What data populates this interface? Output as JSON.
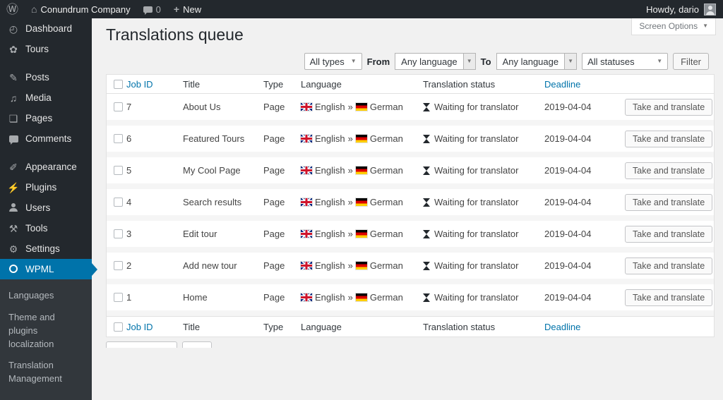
{
  "admin_bar": {
    "site_name": "Conundrum Company",
    "comments_count": "0",
    "new_label": "New",
    "howdy_text": "Howdy, dario"
  },
  "sidebar": {
    "items": [
      {
        "label": "Dashboard"
      },
      {
        "label": "Tours"
      },
      {
        "label": "Posts"
      },
      {
        "label": "Media"
      },
      {
        "label": "Pages"
      },
      {
        "label": "Comments"
      },
      {
        "label": "Appearance"
      },
      {
        "label": "Plugins"
      },
      {
        "label": "Users"
      },
      {
        "label": "Tools"
      },
      {
        "label": "Settings"
      },
      {
        "label": "WPML"
      }
    ],
    "wpml_submenu": [
      "Languages",
      "Theme and plugins localization",
      "Translation Management"
    ]
  },
  "page": {
    "title": "Translations queue",
    "screen_options_label": "Screen Options"
  },
  "filters": {
    "types_value": "All types",
    "from_label": "From",
    "from_language_value": "Any language",
    "to_label": "To",
    "to_language_value": "Any language",
    "statuses_value": "All statuses",
    "filter_button_label": "Filter"
  },
  "table": {
    "headers": {
      "job_id": "Job ID",
      "title": "Title",
      "type": "Type",
      "language": "Language",
      "status": "Translation status",
      "deadline": "Deadline"
    },
    "rows": [
      {
        "job_id": "7",
        "title": "About Us",
        "type": "Page",
        "language_from": "English",
        "language_separator": "»",
        "language_to": "German",
        "status": "Waiting for translator",
        "deadline": "2019-04-04",
        "action_label": "Take and translate"
      },
      {
        "job_id": "6",
        "title": "Featured Tours",
        "type": "Page",
        "language_from": "English",
        "language_separator": "»",
        "language_to": "German",
        "status": "Waiting for translator",
        "deadline": "2019-04-04",
        "action_label": "Take and translate"
      },
      {
        "job_id": "5",
        "title": "My Cool Page",
        "type": "Page",
        "language_from": "English",
        "language_separator": "»",
        "language_to": "German",
        "status": "Waiting for translator",
        "deadline": "2019-04-04",
        "action_label": "Take and translate"
      },
      {
        "job_id": "4",
        "title": "Search results",
        "type": "Page",
        "language_from": "English",
        "language_separator": "»",
        "language_to": "German",
        "status": "Waiting for translator",
        "deadline": "2019-04-04",
        "action_label": "Take and translate"
      },
      {
        "job_id": "3",
        "title": "Edit tour",
        "type": "Page",
        "language_from": "English",
        "language_separator": "»",
        "language_to": "German",
        "status": "Waiting for translator",
        "deadline": "2019-04-04",
        "action_label": "Take and translate"
      },
      {
        "job_id": "2",
        "title": "Add new tour",
        "type": "Page",
        "language_from": "English",
        "language_separator": "»",
        "language_to": "German",
        "status": "Waiting for translator",
        "deadline": "2019-04-04",
        "action_label": "Take and translate"
      },
      {
        "job_id": "1",
        "title": "Home",
        "type": "Page",
        "language_from": "English",
        "language_separator": "»",
        "language_to": "German",
        "status": "Waiting for translator",
        "deadline": "2019-04-04",
        "action_label": "Take and translate"
      }
    ]
  },
  "icons": {
    "wordpress": "Ⓦ",
    "home": "⌂",
    "plus": "+",
    "chevron_down": "▼",
    "dashboard": "◴",
    "tours": "✿",
    "posts": "✎",
    "media": "♫",
    "pages": "❏",
    "comments": "css-bubble",
    "appearance": "✐",
    "plugins": "⚡",
    "users": "css-person",
    "tools": "⚒",
    "settings": "⚙",
    "wpml": "css-circle",
    "status_hourglass": "css-hourglass",
    "uk_flag": "css-uk-flag",
    "germany_flag": "css-germany-flag"
  },
  "colors": {
    "admin_bar_bg": "#23282d",
    "sidebar_bg": "#23282d",
    "submenu_bg": "#32373c",
    "accent": "#0073aa",
    "link": "#0073aa",
    "content_bg": "#f1f1f1",
    "table_bg": "#ffffff",
    "germany_flag_gold": "#ffce00",
    "uk_flag_blue": "#00247d"
  }
}
